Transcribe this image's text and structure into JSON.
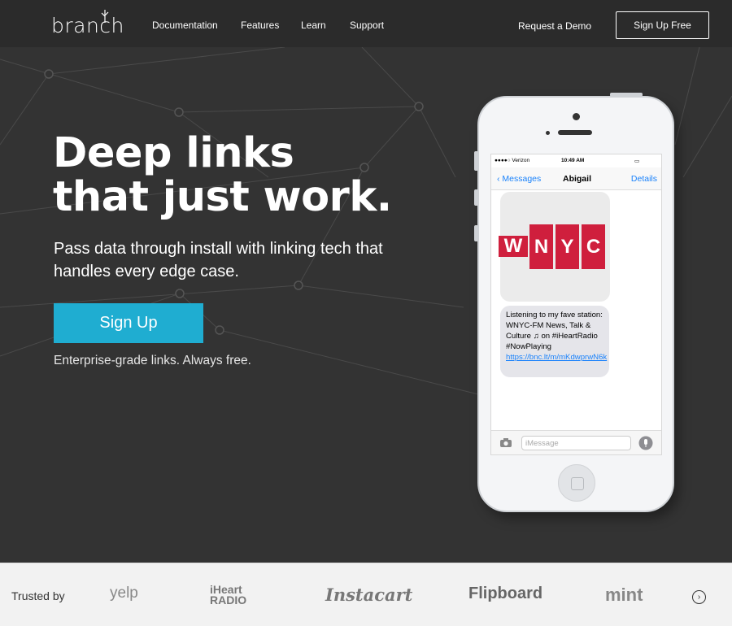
{
  "nav": {
    "logo": "branch",
    "links": [
      "Documentation",
      "Features",
      "Learn",
      "Support"
    ],
    "request_demo": "Request a Demo",
    "signup": "Sign Up Free"
  },
  "hero": {
    "headline": "Deep links that just work.",
    "subheadline": "Pass data through install with linking tech that handles every edge case.",
    "cta": "Sign Up",
    "tagline": "Enterprise-grade links. Always free."
  },
  "phone": {
    "carrier": "●●●●○ Verizon",
    "time": "10:49 AM",
    "back_label": "Messages",
    "contact": "Abigail",
    "details_label": "Details",
    "logo_letters": [
      "W",
      "N",
      "Y",
      "C"
    ],
    "message_text": "Listening to my fave station: WNYC-FM News, Talk & Culture ♫ on #iHeartRadio #NowPlaying",
    "message_link": "https://bnc.lt/m/mKdwprwN6k",
    "input_placeholder": "iMessage"
  },
  "trusted": {
    "label": "Trusted by",
    "brands": [
      "yelp",
      "iHeart RADIO",
      "Instacart",
      "Flipboard",
      "mint"
    ]
  },
  "colors": {
    "accent": "#1fadd1",
    "background": "#333333",
    "nav_background": "#2b2b2b",
    "wnyc_red": "#cf1f3d",
    "ios_blue": "#1a82fb"
  }
}
